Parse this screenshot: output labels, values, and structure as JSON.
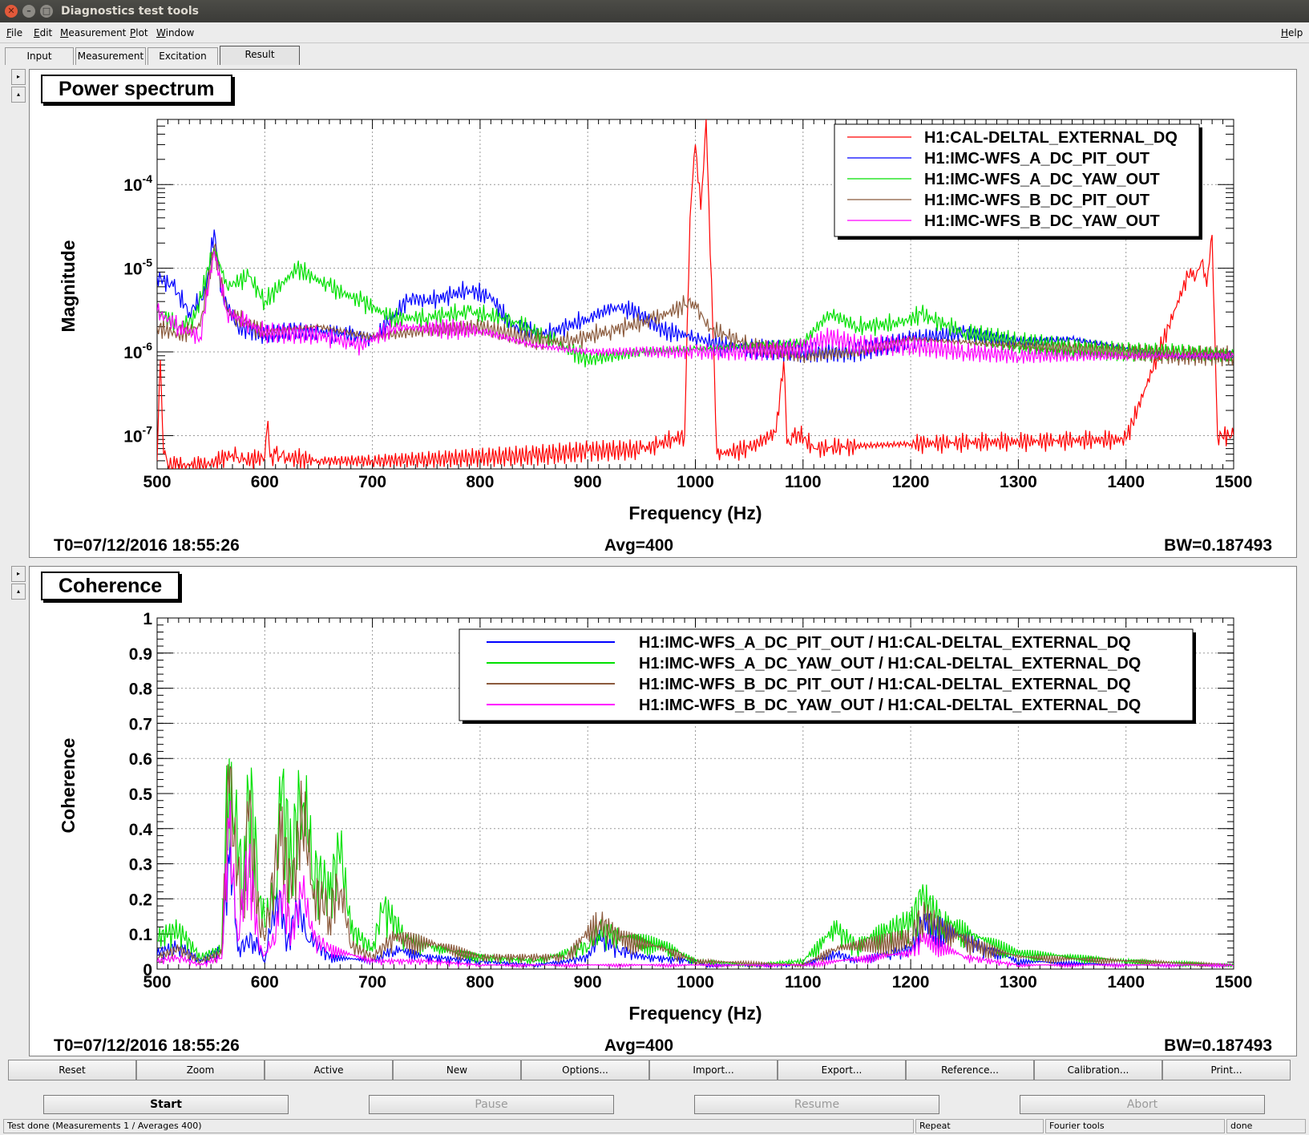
{
  "window": {
    "title": "Diagnostics test tools"
  },
  "menu": {
    "items": [
      "File",
      "Edit",
      "Measurement",
      "Plot",
      "Window"
    ],
    "help": "Help"
  },
  "tabs": [
    {
      "label": "Input",
      "active": false
    },
    {
      "label": "Measurement",
      "active": false
    },
    {
      "label": "Excitation",
      "active": false
    },
    {
      "label": "Result",
      "active": true
    }
  ],
  "colors": {
    "red": "#ff0000",
    "blue": "#0000ff",
    "green": "#00e000",
    "brown": "#8b5a3c",
    "magenta": "#ff00ff"
  },
  "panels": [
    {
      "title": "Power spectrum",
      "footer": {
        "t0": "T0=07/12/2016 18:55:26",
        "avg": "Avg=400",
        "bw": "BW=0.187493"
      }
    },
    {
      "title": "Coherence",
      "footer": {
        "t0": "T0=07/12/2016 18:55:26",
        "avg": "Avg=400",
        "bw": "BW=0.187493"
      }
    }
  ],
  "chart_data": [
    {
      "type": "line",
      "title": "Power spectrum",
      "xlabel": "Frequency (Hz)",
      "ylabel": "Magnitude",
      "xlim": [
        500,
        1500
      ],
      "ylim": [
        4e-08,
        0.0006
      ],
      "yscale": "log",
      "xticks": [
        500,
        600,
        700,
        800,
        900,
        1000,
        1100,
        1200,
        1300,
        1400,
        1500
      ],
      "yticks": [
        {
          "value": 1e-07,
          "base": "10",
          "exp": "-7"
        },
        {
          "value": 1e-06,
          "base": "10",
          "exp": "-6"
        },
        {
          "value": 1e-05,
          "base": "10",
          "exp": "-5"
        },
        {
          "value": 0.0001,
          "base": "10",
          "exp": "-4"
        }
      ],
      "grid": true,
      "legend_position": "top-right",
      "series": [
        {
          "name": "H1:CAL-DELTAL_EXTERNAL_DQ",
          "color": "#ff0000",
          "x": [
            500,
            503,
            506,
            510,
            530,
            550,
            570,
            580,
            600,
            603,
            605,
            610,
            620,
            650,
            700,
            750,
            800,
            850,
            900,
            950,
            990,
            995,
            1000,
            1005,
            1010,
            1020,
            1050,
            1075,
            1082,
            1085,
            1095,
            1110,
            1150,
            1200,
            1300,
            1400,
            1460,
            1465,
            1470,
            1475,
            1480,
            1485,
            1500
          ],
          "y": [
            5e-08,
            8e-07,
            6e-08,
            4.5e-08,
            4.3e-08,
            4.6e-08,
            6e-08,
            5e-08,
            5.5e-08,
            1.5e-07,
            5.5e-08,
            6e-08,
            5.5e-08,
            5e-08,
            5e-08,
            5.2e-08,
            5.5e-08,
            5.8e-08,
            6.5e-08,
            6.8e-08,
            1e-07,
            4e-05,
            0.0003,
            5e-05,
            0.0006,
            6e-08,
            7e-08,
            1.1e-07,
            8e-07,
            8e-08,
            1.1e-07,
            7e-08,
            7.5e-08,
            8e-08,
            8.5e-08,
            9e-08,
            1e-05,
            8e-06,
            1.2e-05,
            6e-06,
            2.5e-05,
            1e-07,
            1e-07
          ]
        },
        {
          "name": "H1:IMC-WFS_A_DC_PIT_OUT",
          "color": "#0000ff",
          "x": [
            500,
            515,
            530,
            545,
            553,
            560,
            575,
            600,
            625,
            650,
            685,
            700,
            735,
            750,
            790,
            810,
            830,
            860,
            900,
            925,
            945,
            970,
            1000,
            1020,
            1050,
            1100,
            1150,
            1200,
            1250,
            1300,
            1350,
            1400,
            1450,
            1500
          ],
          "y": [
            8e-06,
            6e-06,
            3e-06,
            5e-06,
            2.9e-05,
            5e-06,
            2e-06,
            1.6e-06,
            1.8e-06,
            1.7e-06,
            1.6e-06,
            1.4e-06,
            4.5e-06,
            4e-06,
            5.5e-06,
            4.5e-06,
            2e-06,
            1.6e-06,
            2.5e-06,
            3.5e-06,
            3e-06,
            1.8e-06,
            1.5e-06,
            1.2e-06,
            1.1e-06,
            1e-06,
            1e-06,
            1.4e-06,
            1.7e-06,
            1.3e-06,
            1.4e-06,
            1.1e-06,
            9e-07,
            9e-07
          ]
        },
        {
          "name": "H1:IMC-WFS_A_DC_YAW_OUT",
          "color": "#00e000",
          "x": [
            500,
            520,
            535,
            553,
            565,
            585,
            600,
            630,
            660,
            690,
            720,
            750,
            790,
            830,
            870,
            900,
            950,
            1000,
            1050,
            1100,
            1125,
            1150,
            1190,
            1210,
            1250,
            1300,
            1350,
            1400,
            1450,
            1500
          ],
          "y": [
            3e-06,
            2e-06,
            2.5e-06,
            1.8e-05,
            6e-06,
            8e-06,
            4e-06,
            1e-05,
            6e-06,
            4e-06,
            2.5e-06,
            2.6e-06,
            3e-06,
            2.4e-06,
            1.3e-06,
            8e-07,
            1e-06,
            1.1e-06,
            1.2e-06,
            1.3e-06,
            2.9e-06,
            2e-06,
            2.2e-06,
            2.8e-06,
            1.7e-06,
            1.3e-06,
            1.1e-06,
            1e-06,
            1e-06,
            9e-07
          ]
        },
        {
          "name": "H1:IMC-WFS_B_DC_PIT_OUT",
          "color": "#8b5a3c",
          "x": [
            500,
            520,
            540,
            553,
            565,
            600,
            650,
            700,
            750,
            800,
            850,
            880,
            920,
            960,
            990,
            1000,
            1010,
            1050,
            1100,
            1150,
            1200,
            1250,
            1300,
            1350,
            1400,
            1450,
            1500
          ],
          "y": [
            2e-06,
            1.6e-06,
            2e-06,
            1.8e-05,
            3e-06,
            1.7e-06,
            2e-06,
            1.5e-06,
            1.8e-06,
            2e-06,
            1.4e-06,
            1.3e-06,
            1.8e-06,
            2.4e-06,
            3.6e-06,
            4e-06,
            2e-06,
            1.2e-06,
            9e-07,
            1e-06,
            1.4e-06,
            1.3e-06,
            1.2e-06,
            1.1e-06,
            1e-06,
            9e-07,
            9e-07
          ]
        },
        {
          "name": "H1:IMC-WFS_B_DC_YAW_OUT",
          "color": "#ff00ff",
          "x": [
            500,
            520,
            540,
            553,
            565,
            600,
            650,
            690,
            720,
            800,
            850,
            900,
            950,
            1000,
            1050,
            1100,
            1125,
            1150,
            1200,
            1250,
            1300,
            1350,
            1400,
            1450,
            1500
          ],
          "y": [
            3e-06,
            2e-06,
            1.5e-06,
            1.6e-05,
            3e-06,
            1.7e-06,
            1.6e-06,
            1.2e-06,
            2e-06,
            1.8e-06,
            1.2e-06,
            1e-06,
            1e-06,
            1e-06,
            1e-06,
            1.1e-06,
            1.5e-06,
            1.2e-06,
            1.2e-06,
            1e-06,
            9e-07,
            9e-07,
            9e-07,
            9e-07,
            9e-07
          ]
        }
      ]
    },
    {
      "type": "line",
      "title": "Coherence",
      "xlabel": "Frequency (Hz)",
      "ylabel": "Coherence",
      "xlim": [
        500,
        1500
      ],
      "ylim": [
        0,
        1
      ],
      "xticks": [
        500,
        600,
        700,
        800,
        900,
        1000,
        1100,
        1200,
        1300,
        1400,
        1500
      ],
      "yticks": [
        0,
        0.1,
        0.2,
        0.3,
        0.4,
        0.5,
        0.6,
        0.7,
        0.8,
        0.9,
        1
      ],
      "grid": true,
      "legend_position": "top-right",
      "series": [
        {
          "name": "H1:IMC-WFS_A_DC_PIT_OUT / H1:CAL-DELTAL_EXTERNAL_DQ",
          "color": "#0000ff",
          "x": [
            500,
            520,
            540,
            560,
            567,
            570,
            575,
            590,
            600,
            605,
            615,
            620,
            630,
            640,
            650,
            660,
            700,
            720,
            750,
            800,
            850,
            880,
            900,
            910,
            930,
            950,
            1000,
            1010,
            1050,
            1100,
            1130,
            1150,
            1180,
            1200,
            1210,
            1250,
            1270,
            1300,
            1400,
            1500
          ],
          "y": [
            0.04,
            0.06,
            0.02,
            0.05,
            0.3,
            0.25,
            0.05,
            0.08,
            0.02,
            0.1,
            0.2,
            0.05,
            0.16,
            0.08,
            0.06,
            0.03,
            0.02,
            0.05,
            0.03,
            0.02,
            0.01,
            0.02,
            0.03,
            0.08,
            0.05,
            0.03,
            0.02,
            0.01,
            0.01,
            0.01,
            0.04,
            0.02,
            0.04,
            0.05,
            0.12,
            0.08,
            0.05,
            0.02,
            0.01,
            0.01
          ]
        },
        {
          "name": "H1:IMC-WFS_A_DC_YAW_OUT / H1:CAL-DELTAL_EXTERNAL_DQ",
          "color": "#00e000",
          "x": [
            500,
            520,
            540,
            560,
            567,
            570,
            580,
            585,
            595,
            600,
            610,
            615,
            625,
            635,
            645,
            660,
            670,
            680,
            700,
            710,
            730,
            760,
            800,
            850,
            880,
            900,
            910,
            930,
            970,
            1000,
            1050,
            1100,
            1130,
            1150,
            1180,
            1200,
            1210,
            1230,
            1260,
            1300,
            1400,
            1500
          ],
          "y": [
            0.08,
            0.1,
            0.03,
            0.05,
            0.6,
            0.45,
            0.2,
            0.5,
            0.2,
            0.12,
            0.2,
            0.45,
            0.3,
            0.46,
            0.25,
            0.2,
            0.3,
            0.1,
            0.05,
            0.16,
            0.08,
            0.05,
            0.03,
            0.02,
            0.04,
            0.06,
            0.1,
            0.08,
            0.06,
            0.02,
            0.01,
            0.02,
            0.1,
            0.06,
            0.1,
            0.12,
            0.18,
            0.12,
            0.08,
            0.04,
            0.02,
            0.01
          ]
        },
        {
          "name": "H1:IMC-WFS_B_DC_PIT_OUT / H1:CAL-DELTAL_EXTERNAL_DQ",
          "color": "#8b5a3c",
          "x": [
            500,
            520,
            540,
            560,
            567,
            570,
            580,
            585,
            595,
            600,
            615,
            625,
            635,
            645,
            660,
            670,
            680,
            700,
            720,
            760,
            800,
            880,
            910,
            930,
            970,
            1000,
            1100,
            1130,
            1200,
            1210,
            1230,
            1260,
            1300,
            1400,
            1500
          ],
          "y": [
            0.03,
            0.05,
            0.02,
            0.04,
            0.5,
            0.35,
            0.15,
            0.42,
            0.12,
            0.08,
            0.35,
            0.2,
            0.4,
            0.2,
            0.15,
            0.22,
            0.06,
            0.03,
            0.08,
            0.06,
            0.03,
            0.03,
            0.12,
            0.08,
            0.05,
            0.02,
            0.01,
            0.05,
            0.08,
            0.14,
            0.1,
            0.06,
            0.03,
            0.02,
            0.01
          ]
        },
        {
          "name": "H1:IMC-WFS_B_DC_YAW_OUT / H1:CAL-DELTAL_EXTERNAL_DQ",
          "color": "#ff00ff",
          "x": [
            500,
            520,
            540,
            560,
            567,
            570,
            575,
            585,
            595,
            600,
            610,
            615,
            625,
            635,
            645,
            660,
            700,
            750,
            800,
            900,
            1000,
            1100,
            1200,
            1210,
            1250,
            1300,
            1400,
            1500
          ],
          "y": [
            0.02,
            0.03,
            0.01,
            0.03,
            0.4,
            0.25,
            0.08,
            0.3,
            0.05,
            0.04,
            0.08,
            0.22,
            0.1,
            0.2,
            0.08,
            0.05,
            0.02,
            0.02,
            0.01,
            0.01,
            0.01,
            0.01,
            0.04,
            0.08,
            0.03,
            0.01,
            0.01,
            0.01
          ]
        }
      ]
    }
  ],
  "actions": [
    "Reset",
    "Zoom",
    "Active",
    "New",
    "Options...",
    "Import...",
    "Export...",
    "Reference...",
    "Calibration...",
    "Print..."
  ],
  "run": [
    {
      "label": "Start",
      "enabled": true
    },
    {
      "label": "Pause",
      "enabled": false
    },
    {
      "label": "Resume",
      "enabled": false
    },
    {
      "label": "Abort",
      "enabled": false
    }
  ],
  "status": {
    "message": "Test done (Measurements 1 / Averages 400)",
    "mode": "Repeat",
    "tool": "Fourier tools",
    "state": "done"
  }
}
